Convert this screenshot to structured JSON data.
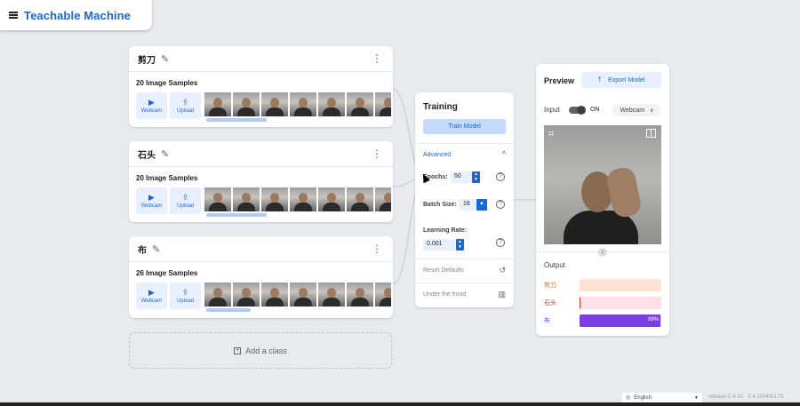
{
  "app": {
    "title": "Teachable Machine"
  },
  "classes": [
    {
      "name": "剪刀",
      "samples": "20 Image Samples"
    },
    {
      "name": "石头",
      "samples": "20 Image Samples"
    },
    {
      "name": "布",
      "samples": "26 Image Samples"
    }
  ],
  "sample_buttons": {
    "webcam": "Webcam",
    "upload": "Upload"
  },
  "add_class": "Add a class",
  "training": {
    "title": "Training",
    "train_button": "Train Model",
    "advanced": "Advanced",
    "epochs_label": "Epochs:",
    "epochs_value": "50",
    "batch_label": "Batch Size:",
    "batch_value": "16",
    "lr_label": "Learning Rate:",
    "lr_value": "0.001",
    "reset": "Reset Defaults",
    "under_hood": "Under the hood"
  },
  "preview": {
    "title": "Preview",
    "export_button": "Export Model",
    "input_label": "Input",
    "toggle_state": "ON",
    "source_select": "Webcam",
    "output_label": "Output",
    "outputs": [
      {
        "name": "剪刀",
        "color": "#e8710a",
        "bg": "#fde3d3",
        "fill": 0.0,
        "pct": ""
      },
      {
        "name": "石头",
        "color": "#d93025",
        "bg": "#fce2e6",
        "fill": 0.01,
        "pct": ""
      },
      {
        "name": "布",
        "color": "#7b3fe4",
        "bg": "#e9ddfb",
        "fill": 0.99,
        "pct": "99%"
      }
    ]
  },
  "footer": {
    "language": "English",
    "release": "release-2-4-10 · 2.4.10#40c178"
  }
}
